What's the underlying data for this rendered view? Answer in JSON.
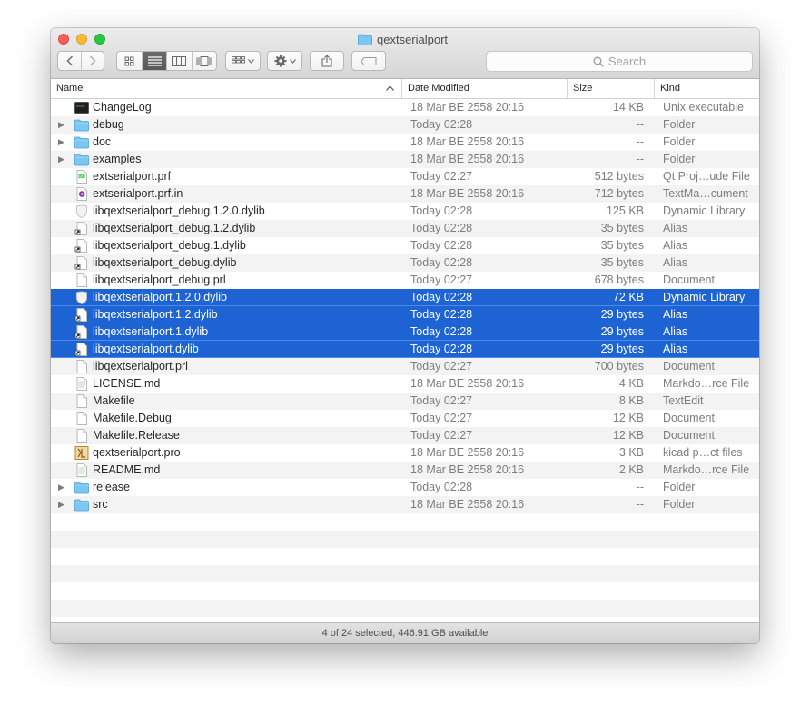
{
  "window": {
    "title": "qextserialport"
  },
  "toolbar": {
    "back_icon": "chevron-left-icon",
    "forward_icon": "chevron-right-icon",
    "view_icons": [
      "icon-view-icon",
      "list-view-icon",
      "column-view-icon",
      "cover-flow-icon"
    ],
    "arrange_icon": "arrange-grid-icon",
    "action_icon": "gear-icon",
    "share_icon": "share-icon",
    "tag_icon": "tag-icon"
  },
  "search": {
    "placeholder": "Search"
  },
  "columns": {
    "name": "Name",
    "date": "Date Modified",
    "size": "Size",
    "kind": "Kind"
  },
  "files": [
    {
      "name": "ChangeLog",
      "date": "18 Mar BE 2558 20:16",
      "size": "14 KB",
      "kind": "Unix executable",
      "icon": "exec",
      "folder": false,
      "selected": false
    },
    {
      "name": "debug",
      "date": "Today 02:28",
      "size": "--",
      "kind": "Folder",
      "icon": "folder",
      "folder": true,
      "selected": false
    },
    {
      "name": "doc",
      "date": "18 Mar BE 2558 20:16",
      "size": "--",
      "kind": "Folder",
      "icon": "folder",
      "folder": true,
      "selected": false
    },
    {
      "name": "examples",
      "date": "18 Mar BE 2558 20:16",
      "size": "--",
      "kind": "Folder",
      "icon": "folder",
      "folder": true,
      "selected": false
    },
    {
      "name": "extserialport.prf",
      "date": "Today 02:27",
      "size": "512 bytes",
      "kind": "Qt Proj…ude File",
      "icon": "qt",
      "folder": false,
      "selected": false
    },
    {
      "name": "extserialport.prf.in",
      "date": "18 Mar BE 2558 20:16",
      "size": "712 bytes",
      "kind": "TextMa…cument",
      "icon": "textmate",
      "folder": false,
      "selected": false
    },
    {
      "name": "libqextserialport_debug.1.2.0.dylib",
      "date": "Today 02:28",
      "size": "125 KB",
      "kind": "Dynamic Library",
      "icon": "dylib",
      "folder": false,
      "selected": false
    },
    {
      "name": "libqextserialport_debug.1.2.dylib",
      "date": "Today 02:28",
      "size": "35 bytes",
      "kind": "Alias",
      "icon": "alias",
      "folder": false,
      "selected": false
    },
    {
      "name": "libqextserialport_debug.1.dylib",
      "date": "Today 02:28",
      "size": "35 bytes",
      "kind": "Alias",
      "icon": "alias",
      "folder": false,
      "selected": false
    },
    {
      "name": "libqextserialport_debug.dylib",
      "date": "Today 02:28",
      "size": "35 bytes",
      "kind": "Alias",
      "icon": "alias",
      "folder": false,
      "selected": false
    },
    {
      "name": "libqextserialport_debug.prl",
      "date": "Today 02:27",
      "size": "678 bytes",
      "kind": "Document",
      "icon": "doc",
      "folder": false,
      "selected": false
    },
    {
      "name": "libqextserialport.1.2.0.dylib",
      "date": "Today 02:28",
      "size": "72 KB",
      "kind": "Dynamic Library",
      "icon": "dylib",
      "folder": false,
      "selected": true
    },
    {
      "name": "libqextserialport.1.2.dylib",
      "date": "Today 02:28",
      "size": "29 bytes",
      "kind": "Alias",
      "icon": "alias",
      "folder": false,
      "selected": true
    },
    {
      "name": "libqextserialport.1.dylib",
      "date": "Today 02:28",
      "size": "29 bytes",
      "kind": "Alias",
      "icon": "alias",
      "folder": false,
      "selected": true
    },
    {
      "name": "libqextserialport.dylib",
      "date": "Today 02:28",
      "size": "29 bytes",
      "kind": "Alias",
      "icon": "alias",
      "folder": false,
      "selected": true
    },
    {
      "name": "libqextserialport.prl",
      "date": "Today 02:27",
      "size": "700 bytes",
      "kind": "Document",
      "icon": "doc",
      "folder": false,
      "selected": false
    },
    {
      "name": "LICENSE.md",
      "date": "18 Mar BE 2558 20:16",
      "size": "4 KB",
      "kind": "Markdo…rce File",
      "icon": "markdown",
      "folder": false,
      "selected": false
    },
    {
      "name": "Makefile",
      "date": "Today 02:27",
      "size": "8 KB",
      "kind": "TextEdit",
      "icon": "doc",
      "folder": false,
      "selected": false
    },
    {
      "name": "Makefile.Debug",
      "date": "Today 02:27",
      "size": "12 KB",
      "kind": "Document",
      "icon": "doc",
      "folder": false,
      "selected": false
    },
    {
      "name": "Makefile.Release",
      "date": "Today 02:27",
      "size": "12 KB",
      "kind": "Document",
      "icon": "doc",
      "folder": false,
      "selected": false
    },
    {
      "name": "qextserialport.pro",
      "date": "18 Mar BE 2558 20:16",
      "size": "3 KB",
      "kind": "kicad p…ct files",
      "icon": "kicad",
      "folder": false,
      "selected": false
    },
    {
      "name": "README.md",
      "date": "18 Mar BE 2558 20:16",
      "size": "2 KB",
      "kind": "Markdo…rce File",
      "icon": "markdown",
      "folder": false,
      "selected": false
    },
    {
      "name": "release",
      "date": "Today 02:28",
      "size": "--",
      "kind": "Folder",
      "icon": "folder",
      "folder": true,
      "selected": false
    },
    {
      "name": "src",
      "date": "18 Mar BE 2558 20:16",
      "size": "--",
      "kind": "Folder",
      "icon": "folder",
      "folder": true,
      "selected": false
    }
  ],
  "status": {
    "text": "4 of 24 selected, 446.91 GB available"
  },
  "colors": {
    "selection": "#1e63d4",
    "folder": "#74c1ef",
    "stripe": "#f3f3f3"
  }
}
